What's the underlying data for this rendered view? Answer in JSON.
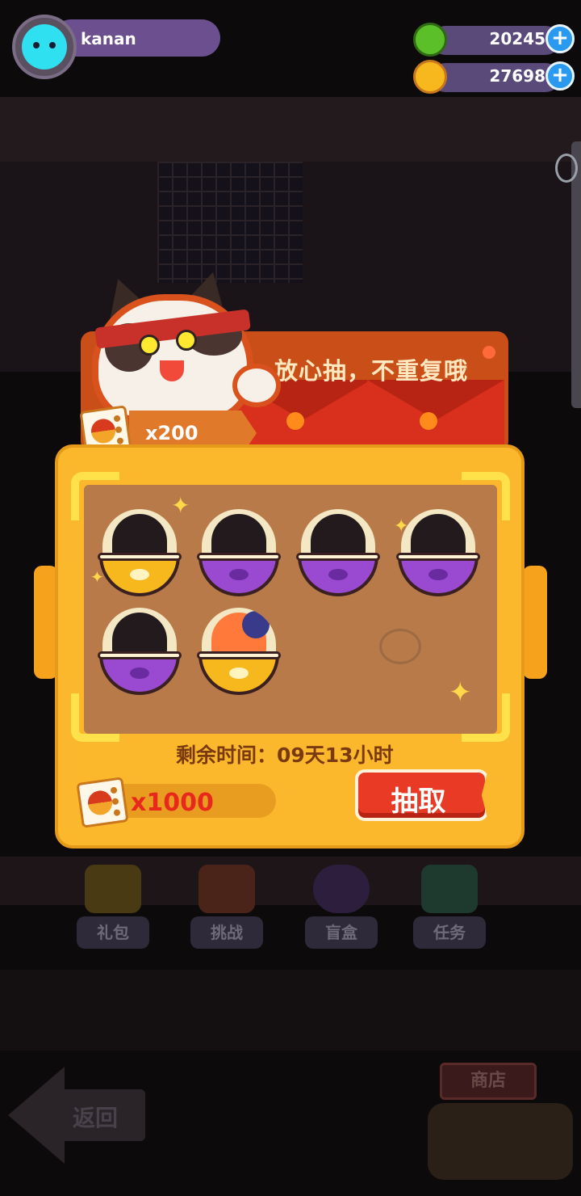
{
  "player": {
    "name": "kanan",
    "avatar_icon": "cat-avatar-icon"
  },
  "currencies": [
    {
      "name": "green-coin",
      "icon": "green-coin-icon",
      "amount": "20245",
      "color": "#5bbf2a"
    },
    {
      "name": "gold-planet",
      "icon": "gold-planet-icon",
      "amount": "27698",
      "color": "#f6b81c"
    }
  ],
  "popup": {
    "slogan": "放心抽，不重复哦",
    "cost_per_draw": "x200",
    "timer_label": "剩余时间：09天13小时",
    "ticket_balance": "x1000",
    "draw_button": "抽取",
    "capsules": [
      {
        "name": "capsule-1",
        "base": "gold",
        "revealed": false
      },
      {
        "name": "capsule-2",
        "base": "purple",
        "revealed": false
      },
      {
        "name": "capsule-3",
        "base": "purple",
        "revealed": false
      },
      {
        "name": "capsule-4",
        "base": "purple",
        "revealed": false
      },
      {
        "name": "capsule-5",
        "base": "purple",
        "revealed": false
      },
      {
        "name": "capsule-6",
        "base": "gold",
        "revealed": true
      }
    ]
  },
  "nav": {
    "items": [
      {
        "label": "礼包",
        "icon": "gift-icon"
      },
      {
        "label": "挑战",
        "icon": "tv-icon"
      },
      {
        "label": "盲盒",
        "icon": "blind-box-icon"
      },
      {
        "label": "任务",
        "icon": "clipboard-icon"
      }
    ],
    "back_label": "返回",
    "shop_label": "商店"
  },
  "colors": {
    "panel": "#fbb82c",
    "draw_button": "#e83a24",
    "capsule_gold": "#f6b81c",
    "capsule_purple": "#9a4ad0"
  }
}
